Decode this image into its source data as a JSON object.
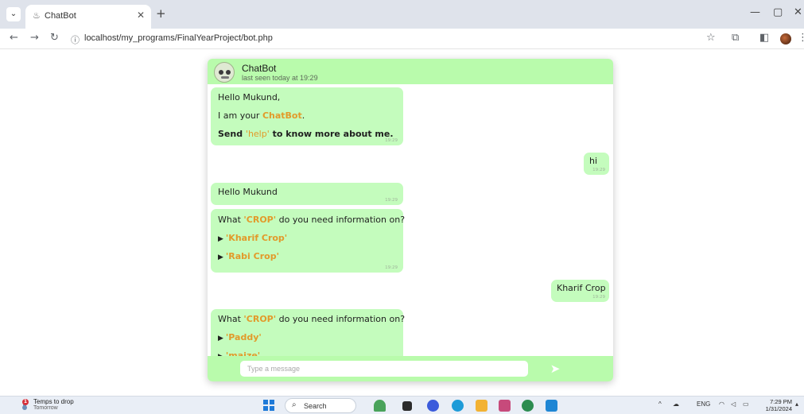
{
  "browser": {
    "tab_title": "ChatBot",
    "tab_close": "✕",
    "new_tab": "+",
    "url": "localhost/my_programs/FinalYearProject/bot.php",
    "window_controls": {
      "minimize": "—",
      "maximize": "▢",
      "close": "✕"
    },
    "icons": [
      "tab-search-icon",
      "back-icon",
      "forward-icon",
      "reload-icon",
      "site-info-icon",
      "star-icon",
      "extensions-icon",
      "side-panel-icon",
      "profile-avatar-icon",
      "more-icon"
    ]
  },
  "chat": {
    "bot_name": "ChatBot",
    "status": "last seen today at 19:29",
    "messages": [
      {
        "from": "bot",
        "greeting": "Hello Mukund,",
        "intro_prefix": "I am your ",
        "intro_bot": "ChatBot",
        "intro_suffix": ".",
        "help_send": "Send ",
        "help_keyword": "'help'",
        "help_suffix": " to know more about me.",
        "time": "19:29"
      },
      {
        "from": "user",
        "text": "hi",
        "time": "19:29"
      },
      {
        "from": "bot",
        "text": "Hello Mukund",
        "time": "19:29"
      },
      {
        "from": "bot",
        "question_prefix": "What ",
        "question_keyword": "'CROP'",
        "question_suffix": " do you need information on?",
        "options": [
          "'Kharif Crop'",
          "'Rabi Crop'"
        ],
        "time": "19:29"
      },
      {
        "from": "user",
        "text": "Kharif Crop",
        "time": "19:29"
      },
      {
        "from": "bot",
        "question_prefix": "What ",
        "question_keyword": "'CROP'",
        "question_suffix": " do you need information on?",
        "options": [
          "'Paddy'",
          "'maize'"
        ]
      }
    ],
    "input_placeholder": "Type a message",
    "send_glyph": "➤"
  },
  "taskbar": {
    "weather_title": "Temps to drop",
    "weather_subtitle": "Tomorrow",
    "weather_badge": "1",
    "search_label": "Search",
    "tray_language": "ENG",
    "clock_time": "7:29 PM",
    "clock_date": "1/31/2024"
  },
  "colors": {
    "header_green": "#b9fbac",
    "bubble_green": "#c4fcbd",
    "highlight_orange": "#e29a2a"
  }
}
